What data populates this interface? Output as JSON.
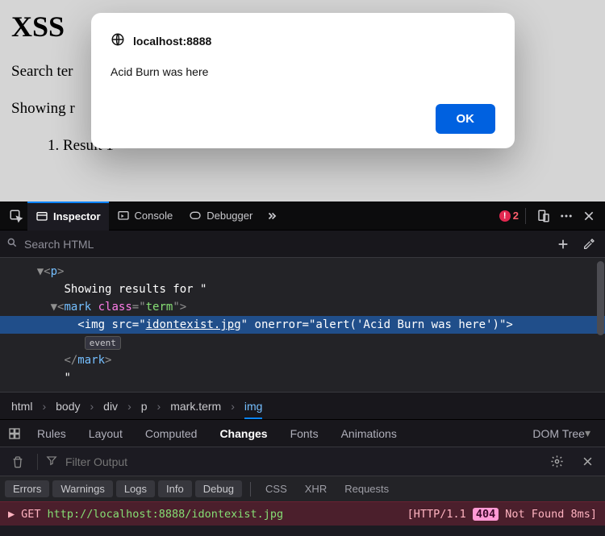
{
  "page": {
    "heading_partial": "XSS ",
    "search_label_partial": "Search ter",
    "results_label_partial": "Showing r",
    "result1": "Result 1"
  },
  "dialog": {
    "origin": "localhost:8888",
    "message": "Acid Burn was here",
    "ok_label": "OK"
  },
  "devtools": {
    "tabs": {
      "inspector": "Inspector",
      "console": "Console",
      "debugger": "Debugger"
    },
    "error_count": "2",
    "search_placeholder": "Search HTML",
    "tree": {
      "line1_text": "Showing results for \"",
      "p_tag": "p",
      "mark_tag": "mark",
      "mark_class_attr": "class",
      "mark_class_val": "term",
      "img_tag": "img",
      "img_src_attr": "src",
      "img_src_val": "idontexist.jpg",
      "img_onerror_attr": "onerror",
      "img_onerror_val": "alert('Acid Burn was here')",
      "event_badge": "event",
      "trailing_quote": "\""
    },
    "breadcrumb": [
      "html",
      "body",
      "div",
      "p",
      "mark.term",
      "img"
    ],
    "subtabs": [
      "Rules",
      "Layout",
      "Computed",
      "Changes",
      "Fonts",
      "Animations",
      "DOM Tree"
    ],
    "active_subtab": "Changes",
    "filter_placeholder": "Filter Output",
    "chips": [
      "Errors",
      "Warnings",
      "Logs",
      "Info",
      "Debug"
    ],
    "chip_labels": [
      "CSS",
      "XHR",
      "Requests"
    ],
    "request": {
      "method": "GET",
      "url": "http://localhost:8888/idontexist.jpg",
      "proto_open": "[HTTP/1.1",
      "status": "404",
      "rest": "Not Found 8ms]"
    }
  }
}
